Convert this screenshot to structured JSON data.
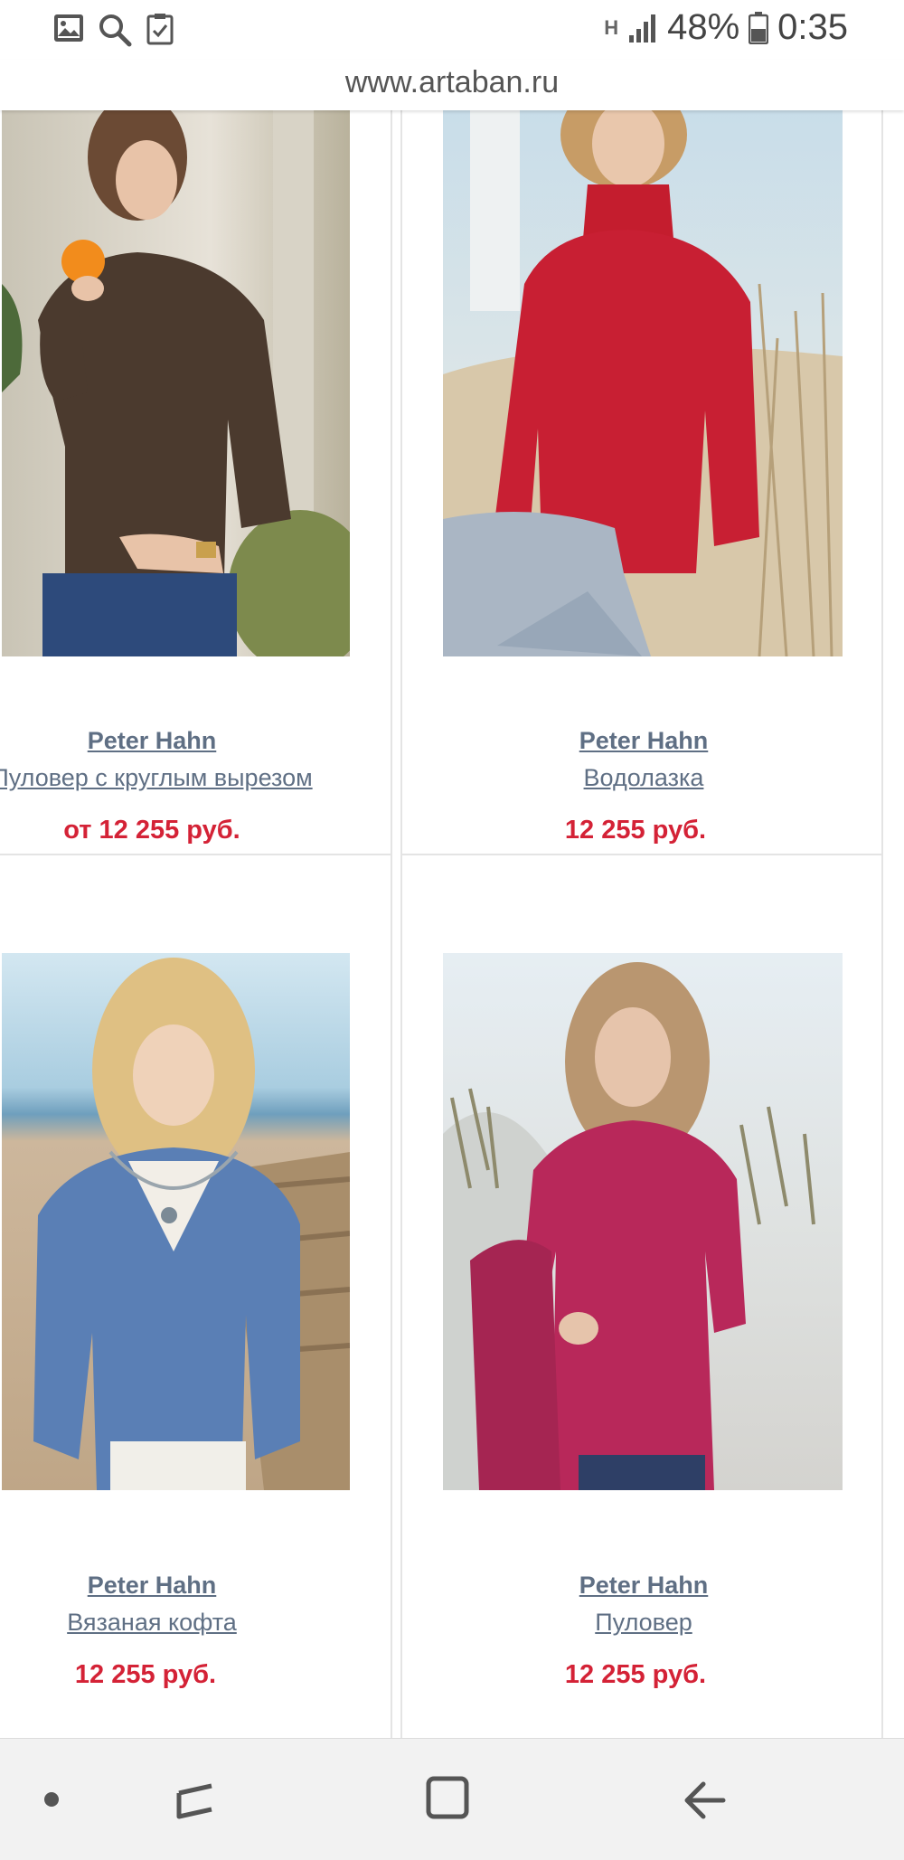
{
  "status_bar": {
    "icons": [
      "gallery-icon",
      "search-icon",
      "task-check-icon"
    ],
    "network_label": "H",
    "battery": "48%",
    "time": "0:35"
  },
  "browser": {
    "url": "www.artaban.ru"
  },
  "products": [
    {
      "brand": "Peter Hahn",
      "name": "Пуловер с круглым вырезом",
      "price": "от 12 255 руб.",
      "photo": "brown-sweater-woman-with-orange"
    },
    {
      "brand": "Peter Hahn",
      "name": "Водолазка",
      "price": "12 255 руб.",
      "photo": "red-turtleneck-woman-on-beach"
    },
    {
      "brand": "Peter Hahn",
      "name": "Вязаная кофта",
      "price": "12 255 руб.",
      "photo": "blue-cardigan-woman-on-boardwalk"
    },
    {
      "brand": "Peter Hahn",
      "name": "Пуловер",
      "price": "12 255 руб.",
      "photo": "raspberry-pullover-woman-on-dunes"
    }
  ],
  "nav_bar": {
    "buttons": [
      "dot-icon",
      "recent-apps-icon",
      "home-icon",
      "back-icon"
    ]
  },
  "colors": {
    "brand_text": "#5f6f84",
    "price": "#d42236",
    "card_border": "#e4e4e4"
  }
}
